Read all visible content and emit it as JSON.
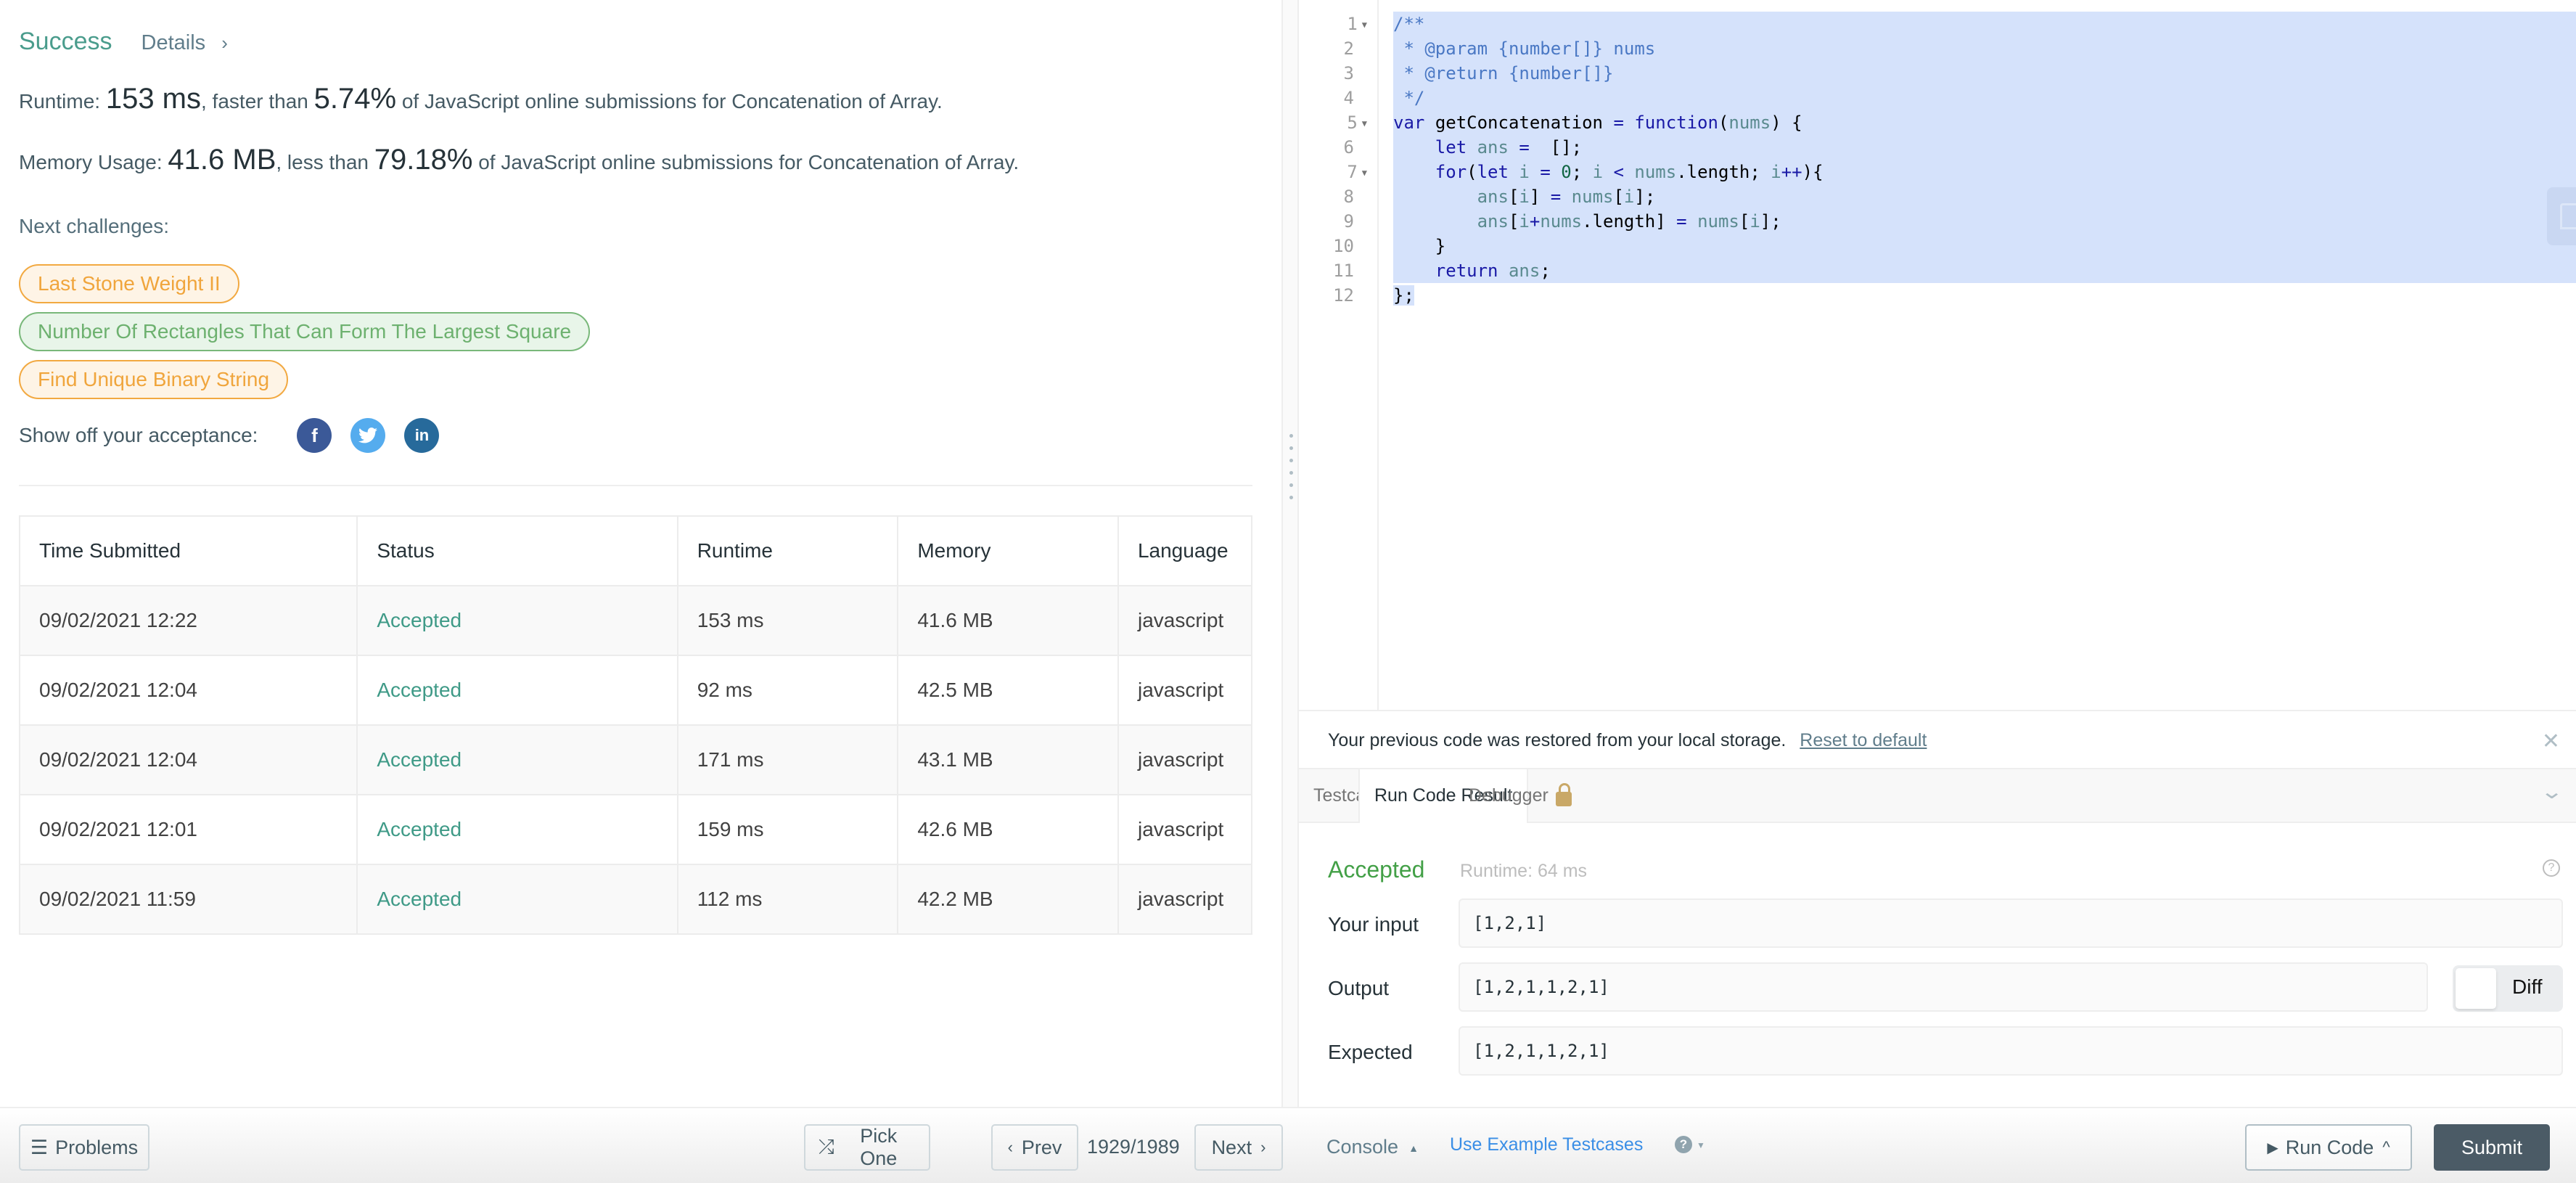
{
  "result": {
    "status": "Success",
    "details_label": "Details",
    "details_chevron": "›",
    "runtime": {
      "label": "Runtime: ",
      "value": "153 ms",
      "comparison": ", faster than ",
      "percent": "5.74%",
      "suffix": " of JavaScript online submissions for Concatenation of Array."
    },
    "memory": {
      "label": "Memory Usage: ",
      "value": "41.6 MB",
      "comparison": ", less than ",
      "percent": "79.18%",
      "suffix": " of JavaScript online submissions for Concatenation of Array."
    },
    "next_challenges_label": "Next challenges:",
    "next_challenges": [
      {
        "title": "Last Stone Weight II",
        "difficulty": "medium"
      },
      {
        "title": "Number Of Rectangles That Can Form The Largest Square",
        "difficulty": "easy"
      },
      {
        "title": "Find Unique Binary String",
        "difficulty": "medium"
      }
    ],
    "share_label": "Show off your acceptance:",
    "share_icons": [
      "facebook-icon",
      "twitter-icon",
      "linkedin-icon"
    ]
  },
  "submissions": {
    "columns": [
      "Time Submitted",
      "Status",
      "Runtime",
      "Memory",
      "Language"
    ],
    "rows": [
      [
        "09/02/2021 12:22",
        "Accepted",
        "153 ms",
        "41.6 MB",
        "javascript"
      ],
      [
        "09/02/2021 12:04",
        "Accepted",
        "92 ms",
        "42.5 MB",
        "javascript"
      ],
      [
        "09/02/2021 12:04",
        "Accepted",
        "171 ms",
        "43.1 MB",
        "javascript"
      ],
      [
        "09/02/2021 12:01",
        "Accepted",
        "159 ms",
        "42.6 MB",
        "javascript"
      ],
      [
        "09/02/2021 11:59",
        "Accepted",
        "112 ms",
        "42.2 MB",
        "javascript"
      ]
    ]
  },
  "editor": {
    "line_numbers": [
      "1",
      "2",
      "3",
      "4",
      "5",
      "6",
      "7",
      "8",
      "9",
      "10",
      "11",
      "12"
    ],
    "foldable_lines": [
      1,
      5,
      7
    ],
    "lines": [
      "/**",
      " * @param {number[]} nums",
      " * @return {number[]}",
      " */",
      "var getConcatenation = function(nums) {",
      "    let ans =  [];",
      "    for(let i = 0; i < nums.length; i++){",
      "        ans[i] = nums[i];",
      "        ans[i+nums.length] = nums[i];",
      "    }",
      "    return ans;",
      "};"
    ]
  },
  "console": {
    "notice": "Your previous code was restored from your local storage.",
    "reset_link": "Reset to default",
    "tabs": [
      "Testcase",
      "Run Code Result",
      "Debugger"
    ],
    "active_tab": "Run Code Result",
    "run_status": "Accepted",
    "run_runtime": "Runtime: 64 ms",
    "input_label": "Your input",
    "input_value": "[1,2,1]",
    "output_label": "Output",
    "output_value": "[1,2,1,1,2,1]",
    "expected_label": "Expected",
    "expected_value": "[1,2,1,1,2,1]",
    "diff_label": "Diff",
    "diff_enabled": false
  },
  "footer": {
    "problems_label": "Problems",
    "pick_one_label": "Pick One",
    "prev_label": "Prev",
    "page_counter": "1929/1989",
    "next_label": "Next",
    "console_label": "Console",
    "example_testcases_label": "Use Example Testcases",
    "run_code_label": "Run Code",
    "submit_label": "Submit"
  },
  "colors": {
    "success": "#4a9c8c",
    "accepted_run": "#43a047",
    "medium_chip": "#f0a53c",
    "easy_chip": "#6db16f",
    "selection": "#d5e2fb",
    "submit_bg": "#4b5b66",
    "link": "#3a8ee6"
  }
}
